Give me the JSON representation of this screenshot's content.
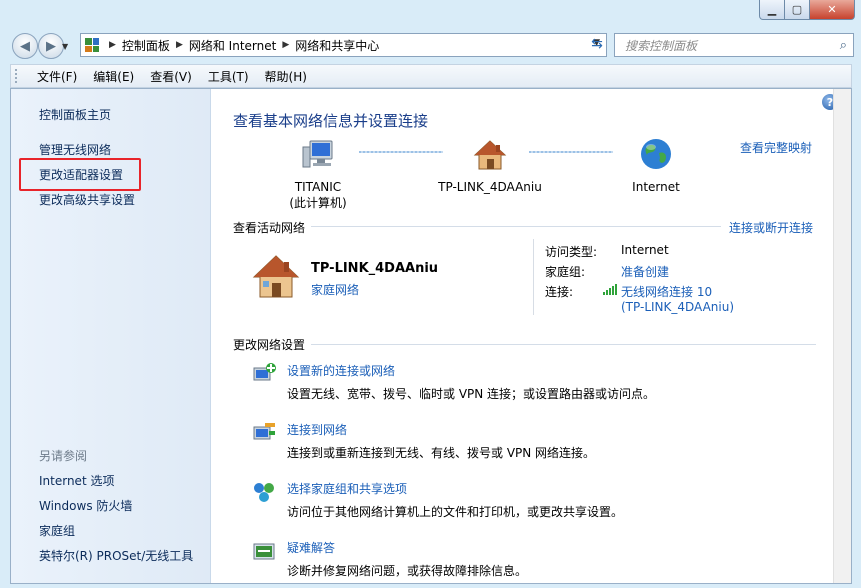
{
  "address": {
    "crumbs": [
      "控制面板",
      "网络和 Internet",
      "网络和共享中心"
    ],
    "search_placeholder": "搜索控制面板"
  },
  "menu": [
    "文件(F)",
    "编辑(E)",
    "查看(V)",
    "工具(T)",
    "帮助(H)"
  ],
  "sidebar": {
    "items": [
      "控制面板主页",
      "管理无线网络",
      "更改适配器设置",
      "更改高级共享设置"
    ],
    "see_also_title": "另请参阅",
    "see_also": [
      "Internet 选项",
      "Windows 防火墙",
      "家庭组",
      "英特尔(R) PROSet/无线工具"
    ]
  },
  "main": {
    "title": "查看基本网络信息并设置连接",
    "full_map_link": "查看完整映射",
    "map": {
      "computer": "TITANIC",
      "computer_sub": "(此计算机)",
      "router": "TP-LINK_4DAAniu",
      "internet": "Internet"
    },
    "active_title": "查看活动网络",
    "connect_link": "连接或断开连接",
    "active": {
      "name": "TP-LINK_4DAAniu",
      "type": "家庭网络",
      "access_label": "访问类型:",
      "access_value": "Internet",
      "homegroup_label": "家庭组:",
      "homegroup_value": "准备创建",
      "conn_label": "连接:",
      "conn_value": "无线网络连接 10",
      "conn_value2": "(TP-LINK_4DAAniu)"
    },
    "change_title": "更改网络设置",
    "tasks": [
      {
        "title": "设置新的连接或网络",
        "desc": "设置无线、宽带、拨号、临时或 VPN 连接；或设置路由器或访问点。"
      },
      {
        "title": "连接到网络",
        "desc": "连接到或重新连接到无线、有线、拨号或 VPN 网络连接。"
      },
      {
        "title": "选择家庭组和共享选项",
        "desc": "访问位于其他网络计算机上的文件和打印机，或更改共享设置。"
      },
      {
        "title": "疑难解答",
        "desc": "诊断并修复网络问题，或获得故障排除信息。"
      }
    ]
  },
  "colors": {
    "link": "#1b5fb8",
    "title": "#1a3e8a",
    "highlight": "#e8242a"
  }
}
